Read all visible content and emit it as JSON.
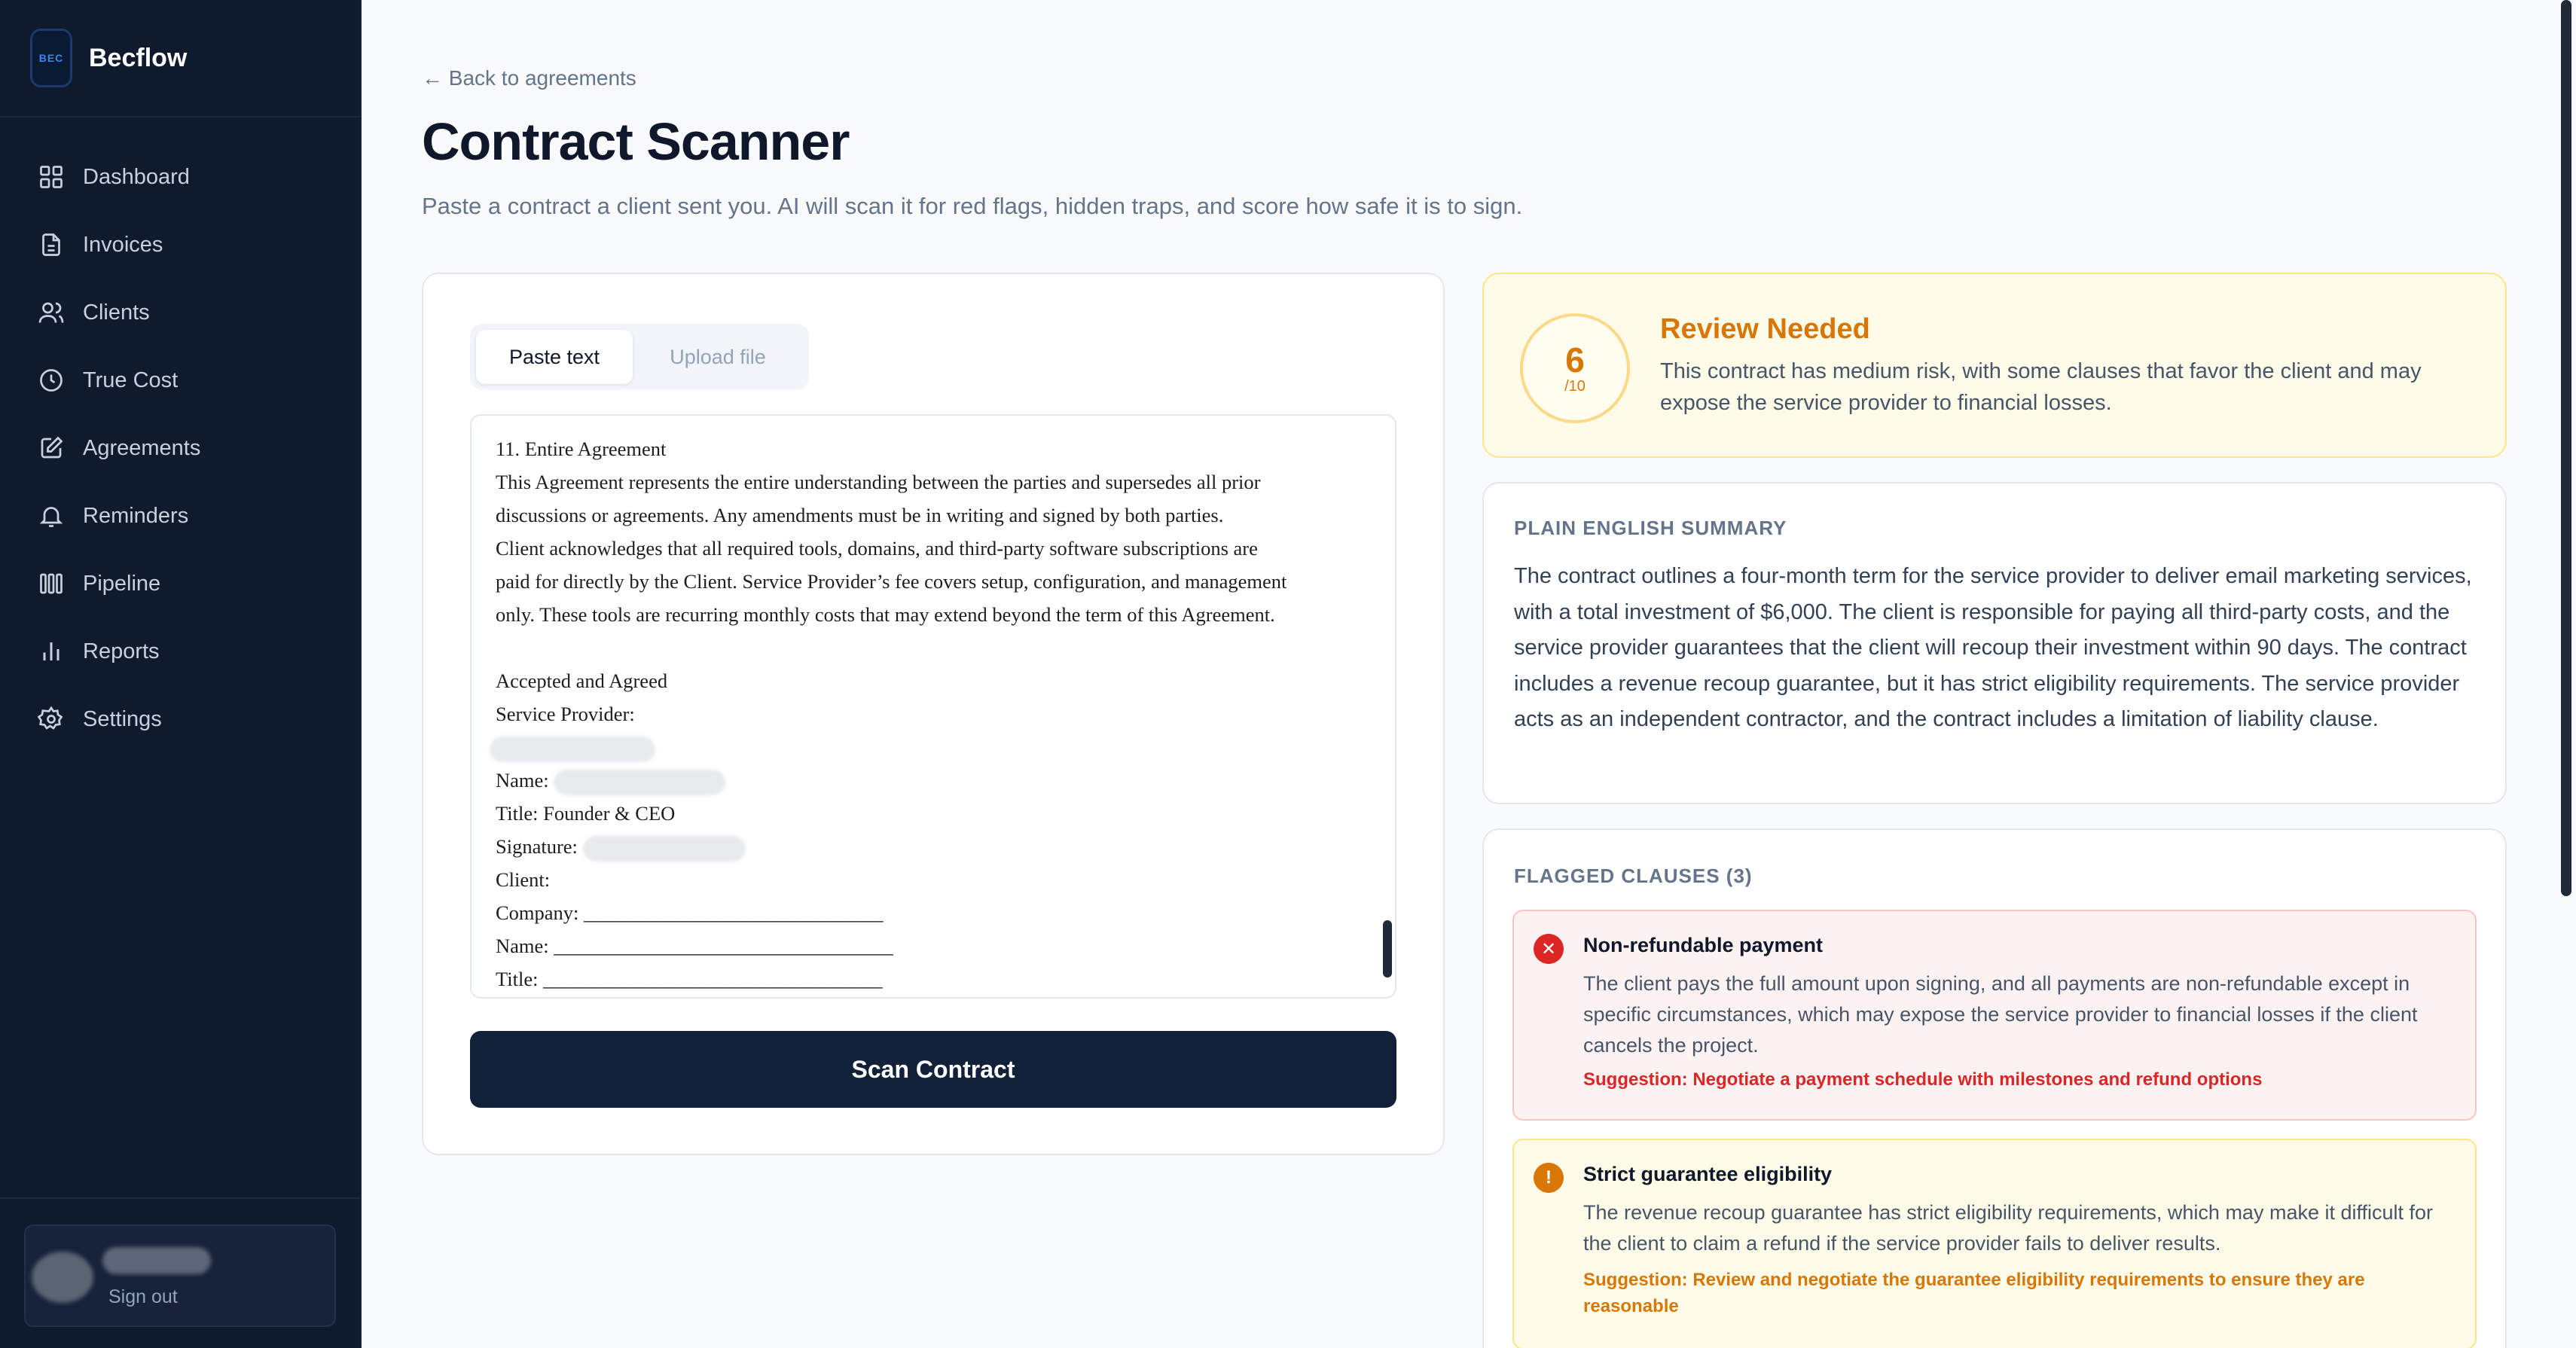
{
  "sidebar": {
    "logo_text": "BEC",
    "brand": "Becflow",
    "items": [
      {
        "label": "Dashboard",
        "icon": "dashboard-grid-icon"
      },
      {
        "label": "Invoices",
        "icon": "document-icon"
      },
      {
        "label": "Clients",
        "icon": "users-icon"
      },
      {
        "label": "True Cost",
        "icon": "clock-icon"
      },
      {
        "label": "Agreements",
        "icon": "edit-icon"
      },
      {
        "label": "Reminders",
        "icon": "bell-icon"
      },
      {
        "label": "Pipeline",
        "icon": "pipeline-bars-icon"
      },
      {
        "label": "Reports",
        "icon": "bar-chart-icon"
      },
      {
        "label": "Settings",
        "icon": "gear-icon"
      }
    ],
    "signout": "Sign out"
  },
  "page": {
    "back_link": "← Back to agreements",
    "title": "Contract Scanner",
    "subtitle": "Paste a contract a client sent you. AI will scan it for red flags, hidden traps, and score how safe it is to sign."
  },
  "input_panel": {
    "tabs": [
      {
        "label": "Paste text",
        "active": true
      },
      {
        "label": "Upload file",
        "active": false
      }
    ],
    "contract_lines": [
      "11. Entire Agreement",
      "This Agreement represents the entire understanding between the parties and supersedes all prior",
      "discussions or agreements. Any amendments must be in writing and signed by both parties.",
      "Client acknowledges that all required tools, domains, and third-party software subscriptions are",
      "paid for directly by the Client. Service Provider’s fee covers setup, configuration, and management",
      "only. These tools are recurring monthly costs that may extend beyond the term of this Agreement.",
      "",
      "Accepted and Agreed",
      "Service Provider:"
    ],
    "signature_lines": {
      "name_label": "Name: ",
      "title_line": "Title: Founder & CEO",
      "signature_label": "Signature: ",
      "client_label": "Client:",
      "company_line": "Company: ______________________________",
      "client_name_line": "Name: __________________________________",
      "client_title_line": "Title: __________________________________"
    },
    "scan_button": "Scan Contract"
  },
  "score": {
    "value": "6",
    "max": "/10",
    "title": "Review Needed",
    "description": "This contract has medium risk, with some clauses that favor the client and may expose the service provider to financial losses.",
    "accent_color": "#d97706"
  },
  "summary": {
    "heading": "PLAIN ENGLISH SUMMARY",
    "text": "The contract outlines a four-month term for the service provider to deliver email marketing services, with a total investment of $6,000. The client is responsible for paying all third-party costs, and the service provider guarantees that the client will recoup their investment within 90 days. The contract includes a revenue recoup guarantee, but it has strict eligibility requirements. The service provider acts as an independent contractor, and the contract includes a limitation of liability clause."
  },
  "flags": {
    "heading": "FLAGGED CLAUSES (3)",
    "items": [
      {
        "severity": "danger",
        "icon": "x-circle-icon",
        "icon_glyph": "✕",
        "title": "Non-refundable payment",
        "description": "The client pays the full amount upon signing, and all payments are non-refundable except in specific circumstances, which may expose the service provider to financial losses if the client cancels the project.",
        "suggestion": "Suggestion: Negotiate a payment schedule with milestones and refund options",
        "color": "#dc2626"
      },
      {
        "severity": "warning",
        "icon": "exclamation-circle-icon",
        "icon_glyph": "!",
        "title": "Strict guarantee eligibility",
        "description": "The revenue recoup guarantee has strict eligibility requirements, which may make it difficult for the client to claim a refund if the service provider fails to deliver results.",
        "suggestion": "Suggestion: Review and negotiate the guarantee eligibility requirements to ensure they are reasonable",
        "color": "#d97706"
      }
    ]
  }
}
